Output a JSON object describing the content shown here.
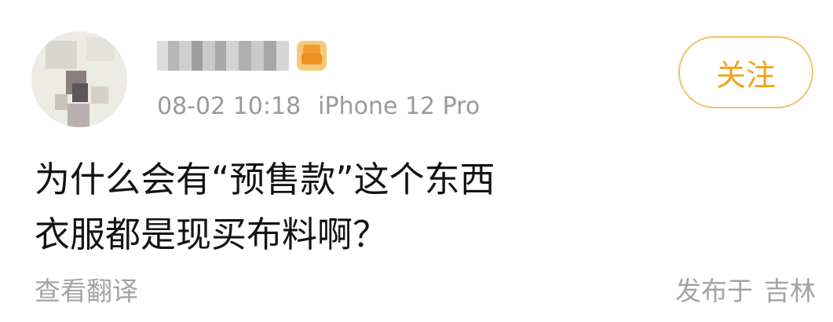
{
  "post": {
    "author": {
      "name_text": "",
      "avatar_icon": "blurred-avatar-image",
      "badge_icon": "vip-crown-icon"
    },
    "meta": {
      "time": "08-02 10:18",
      "device": "iPhone 12 Pro"
    },
    "follow_label": "关注",
    "content_lines": [
      "为什么会有“预售款”这个东西",
      "衣服都是现买布料啊？"
    ],
    "translate_label": "查看翻译",
    "location_prefix": "发布于",
    "location_place": "吉林"
  },
  "colors": {
    "accent": "#f2a318",
    "follow_border": "#f0c26b",
    "meta_text": "#9a9a9a",
    "body_text": "#141414",
    "secondary_text": "#a3a3a3"
  }
}
